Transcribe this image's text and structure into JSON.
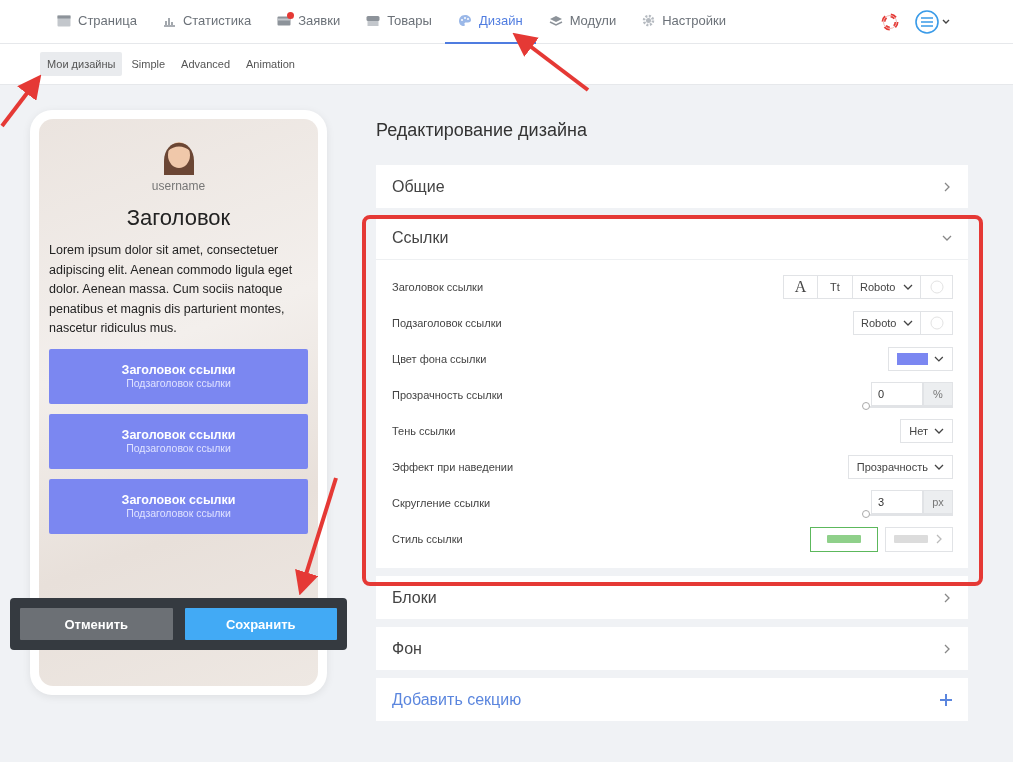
{
  "nav": {
    "items": [
      {
        "label": "Страница",
        "selected": false
      },
      {
        "label": "Статистика",
        "selected": false
      },
      {
        "label": "Заявки",
        "selected": false,
        "badge": true
      },
      {
        "label": "Товары",
        "selected": false
      },
      {
        "label": "Дизайн",
        "selected": true
      },
      {
        "label": "Модули",
        "selected": false
      },
      {
        "label": "Настройки",
        "selected": false
      }
    ]
  },
  "subnav": {
    "tabs": [
      {
        "label": "Мои дизайны",
        "selected": true
      },
      {
        "label": "Simple",
        "selected": false
      },
      {
        "label": "Advanced",
        "selected": false
      },
      {
        "label": "Animation",
        "selected": false
      }
    ]
  },
  "preview": {
    "username": "username",
    "heading": "Заголовок",
    "text": "Lorem ipsum dolor sit amet, consectetuer adipiscing elit. Aenean commodo ligula eget dolor. Aenean massa. Cum sociis natoque penatibus et magnis dis parturient montes, nascetur ridiculus mus.",
    "links": [
      {
        "title": "Заголовок ссылки",
        "subtitle": "Подзаголовок ссылки"
      },
      {
        "title": "Заголовок ссылки",
        "subtitle": "Подзаголовок ссылки"
      },
      {
        "title": "Заголовок ссылки",
        "subtitle": "Подзаголовок ссылки"
      }
    ]
  },
  "save_bar": {
    "cancel": "Отменить",
    "save": "Сохранить"
  },
  "editor": {
    "title": "Редактирование дизайна",
    "sections": [
      {
        "title": "Общие",
        "expanded": false
      },
      {
        "title": "Ссылки",
        "expanded": true,
        "rows": [
          {
            "kind": "font",
            "label": "Заголовок ссылки",
            "style_a": "A",
            "style_t": "Tt",
            "font": "Roboto"
          },
          {
            "kind": "font-simple",
            "label": "Подзаголовок ссылки",
            "font": "Roboto"
          },
          {
            "kind": "color",
            "label": "Цвет фона ссылки"
          },
          {
            "kind": "slider",
            "label": "Прозрачность ссылки",
            "value": "0",
            "unit": "%",
            "level": 0
          },
          {
            "kind": "select",
            "label": "Тень ссылки",
            "value": "Нет"
          },
          {
            "kind": "select",
            "label": "Эффект при наведении",
            "value": "Прозрачность"
          },
          {
            "kind": "slider",
            "label": "Скругление ссылки",
            "value": "3",
            "unit": "px",
            "level": 0
          },
          {
            "kind": "style",
            "label": "Стиль ссылки",
            "options": [
              {
                "selected": true
              },
              {
                "selected": false
              }
            ]
          }
        ]
      },
      {
        "title": "Блоки",
        "expanded": false
      },
      {
        "title": "Фон",
        "expanded": false
      }
    ],
    "add_section": "Добавить секцию"
  }
}
